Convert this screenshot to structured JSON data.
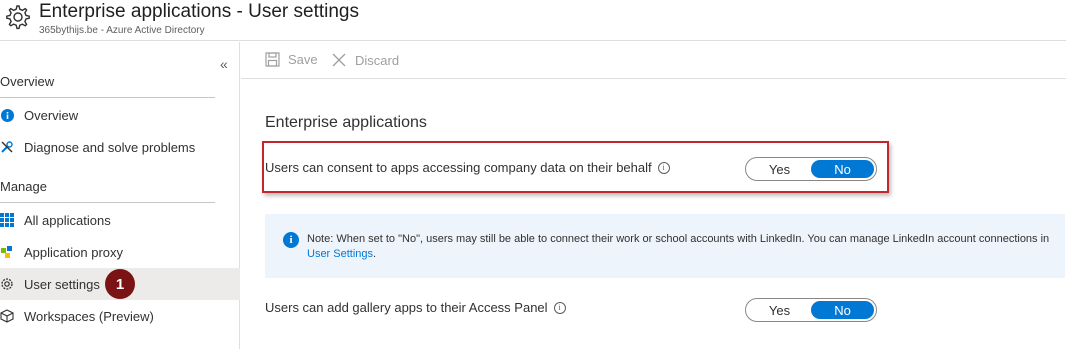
{
  "header": {
    "title": "Enterprise applications - User settings",
    "subtitle": "365bythijs.be - Azure Active Directory",
    "icon": "gear-icon"
  },
  "sidebar": {
    "collapse_glyph": "«",
    "sections": [
      {
        "label": "Overview"
      },
      {
        "label": "Manage"
      }
    ],
    "items": [
      {
        "label": "Overview",
        "icon": "info-icon"
      },
      {
        "label": "Diagnose and solve problems",
        "icon": "wrench-icon"
      },
      {
        "label": "All applications",
        "icon": "grid-icon"
      },
      {
        "label": "Application proxy",
        "icon": "proxy-icon"
      },
      {
        "label": "User settings",
        "icon": "gear-icon",
        "active": true
      },
      {
        "label": "Workspaces (Preview)",
        "icon": "cube-icon"
      }
    ],
    "badge": "1"
  },
  "toolbar": {
    "save_label": "Save",
    "discard_label": "Discard"
  },
  "main": {
    "section_title": "Enterprise applications",
    "settings": [
      {
        "label": "Users can consent to apps accessing company data on their behalf",
        "yes": "Yes",
        "no": "No",
        "selected": "No"
      },
      {
        "label": "Users can add gallery apps to their Access Panel",
        "yes": "Yes",
        "no": "No",
        "selected": "No"
      }
    ],
    "note": {
      "text": "Note: When set to \"No\", users may still be able to connect their work or school accounts with LinkedIn. You can manage LinkedIn account connections in ",
      "link": "User Settings",
      "suffix": "."
    }
  },
  "colors": {
    "accent": "#0078d4",
    "highlight_border": "#c4262e",
    "badge": "#7a1313"
  }
}
